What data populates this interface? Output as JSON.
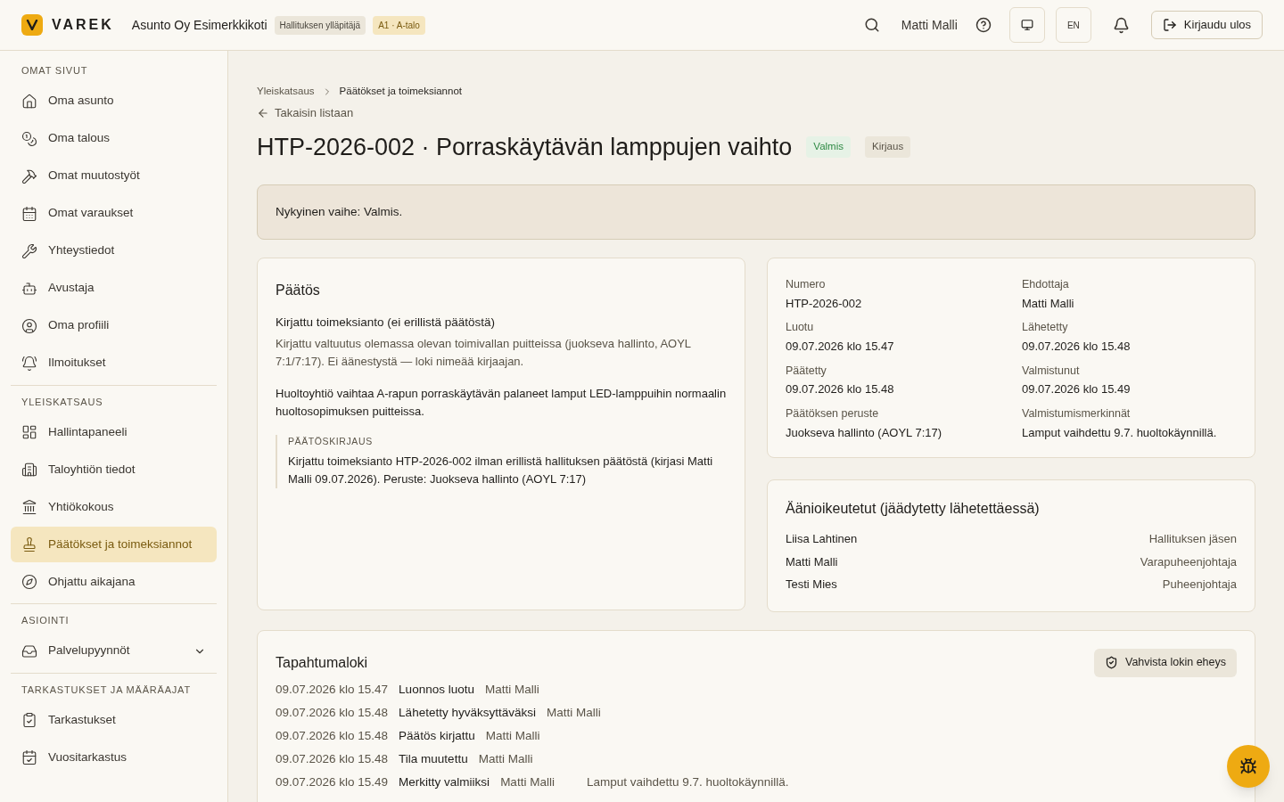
{
  "header": {
    "logo": "VAREK",
    "org": "Asunto Oy Esimerkkikoti",
    "badges": [
      "Hallituksen ylläpitäjä",
      "A1 · A-talo"
    ],
    "user": "Matti Malli",
    "language": "EN",
    "logout": "Kirjaudu ulos"
  },
  "sidebar": {
    "sections": [
      {
        "title": "OMAT SIVUT",
        "items": [
          {
            "label": "Oma asunto",
            "selected": false
          },
          {
            "label": "Oma talous",
            "selected": false
          },
          {
            "label": "Omat muutostyöt",
            "selected": false
          },
          {
            "label": "Omat varaukset",
            "selected": false
          },
          {
            "label": "Yhteystiedot",
            "selected": false
          },
          {
            "label": "Avustaja",
            "selected": false
          },
          {
            "label": "Oma profiili",
            "selected": false
          },
          {
            "label": "Ilmoitukset",
            "selected": false
          }
        ]
      },
      {
        "title": "YLEISKATSAUS",
        "items": [
          {
            "label": "Hallintapaneeli",
            "selected": false
          },
          {
            "label": "Taloyhtiön tiedot",
            "selected": false
          },
          {
            "label": "Yhtiökokous",
            "selected": false
          },
          {
            "label": "Päätökset ja toimeksiannot",
            "selected": true
          },
          {
            "label": "Ohjattu aikajana",
            "selected": false
          }
        ]
      },
      {
        "title": "ASIOINTI",
        "items": [
          {
            "label": "Palvelupyynnöt",
            "selected": false,
            "expanded": false
          }
        ]
      },
      {
        "title": "TARKASTUKSET JA MÄÄRÄAJAT",
        "items": [
          {
            "label": "Tarkastukset",
            "selected": false
          },
          {
            "label": "Vuositarkastus",
            "selected": false
          }
        ]
      }
    ]
  },
  "breadcrumb": [
    "Yleiskatsaus",
    "Päätökset ja toimeksiannot"
  ],
  "back": "Takaisin listaan",
  "title": "HTP-2026-002 · Porraskäytävän lamppujen vaihto",
  "tags": [
    {
      "label": "Valmis",
      "kind": "success"
    },
    {
      "label": "Kirjaus",
      "kind": "neutral"
    }
  ],
  "notice": "Nykyinen vaihe: Valmis.",
  "decision": {
    "title": "Päätös",
    "type": "Kirjattu toimeksianto (ei erillistä päätöstä)",
    "basis_note": "Kirjattu valtuutus olemassa olevan toimivallan puitteissa (juokseva hallinto, AOYL 7:1/7:17). Ei äänestystä — loki nimeää kirjaajan.",
    "description": "Huoltoyhtiö vaihtaa A-rapun porraskäytävän palaneet lamput LED-lamppuihin normaalin huoltosopimuksen puitteissa.",
    "record_label": "PÄÄTÖSKIRJAUS",
    "record": "Kirjattu toimeksianto HTP-2026-002 ilman erillistä hallituksen päätöstä (kirjasi Matti Malli 09.07.2026). Peruste: Juokseva hallinto (AOYL 7:17)"
  },
  "details": [
    {
      "label": "Numero",
      "value": "HTP-2026-002"
    },
    {
      "label": "Ehdottaja",
      "value": "Matti Malli"
    },
    {
      "label": "Luotu",
      "value": "09.07.2026 klo 15.47"
    },
    {
      "label": "Lähetetty",
      "value": "09.07.2026 klo 15.48"
    },
    {
      "label": "Päätetty",
      "value": "09.07.2026 klo 15.48"
    },
    {
      "label": "Valmistunut",
      "value": "09.07.2026 klo 15.49"
    },
    {
      "label": "Päätöksen peruste",
      "value": "Juokseva hallinto (AOYL 7:17)"
    },
    {
      "label": "Valmistumismerkinnät",
      "value": "Lamput vaihdettu 9.7. huoltokäynnillä."
    }
  ],
  "voters": {
    "title": "Äänioikeutetut (jäädytetty lähetettäessä)",
    "rows": [
      {
        "name": "Liisa Lahtinen",
        "role": "Hallituksen jäsen"
      },
      {
        "name": "Matti Malli",
        "role": "Varapuheenjohtaja"
      },
      {
        "name": "Testi Mies",
        "role": "Puheenjohtaja"
      }
    ]
  },
  "log": {
    "title": "Tapahtumaloki",
    "verify": "Vahvista lokin eheys",
    "rows": [
      {
        "time": "09.07.2026 klo 15.47",
        "event": "Luonnos luotu",
        "actor": "Matti Malli"
      },
      {
        "time": "09.07.2026 klo 15.48",
        "event": "Lähetetty hyväksyttäväksi",
        "actor": "Matti Malli"
      },
      {
        "time": "09.07.2026 klo 15.48",
        "event": "Päätös kirjattu",
        "actor": "Matti Malli"
      },
      {
        "time": "09.07.2026 klo 15.48",
        "event": "Tila muutettu",
        "actor": "Matti Malli"
      },
      {
        "time": "09.07.2026 klo 15.49",
        "event": "Merkitty valmiiksi",
        "actor": "Matti Malli",
        "note": "Lamput vaihdettu 9.7. huoltokäynnillä."
      }
    ]
  }
}
